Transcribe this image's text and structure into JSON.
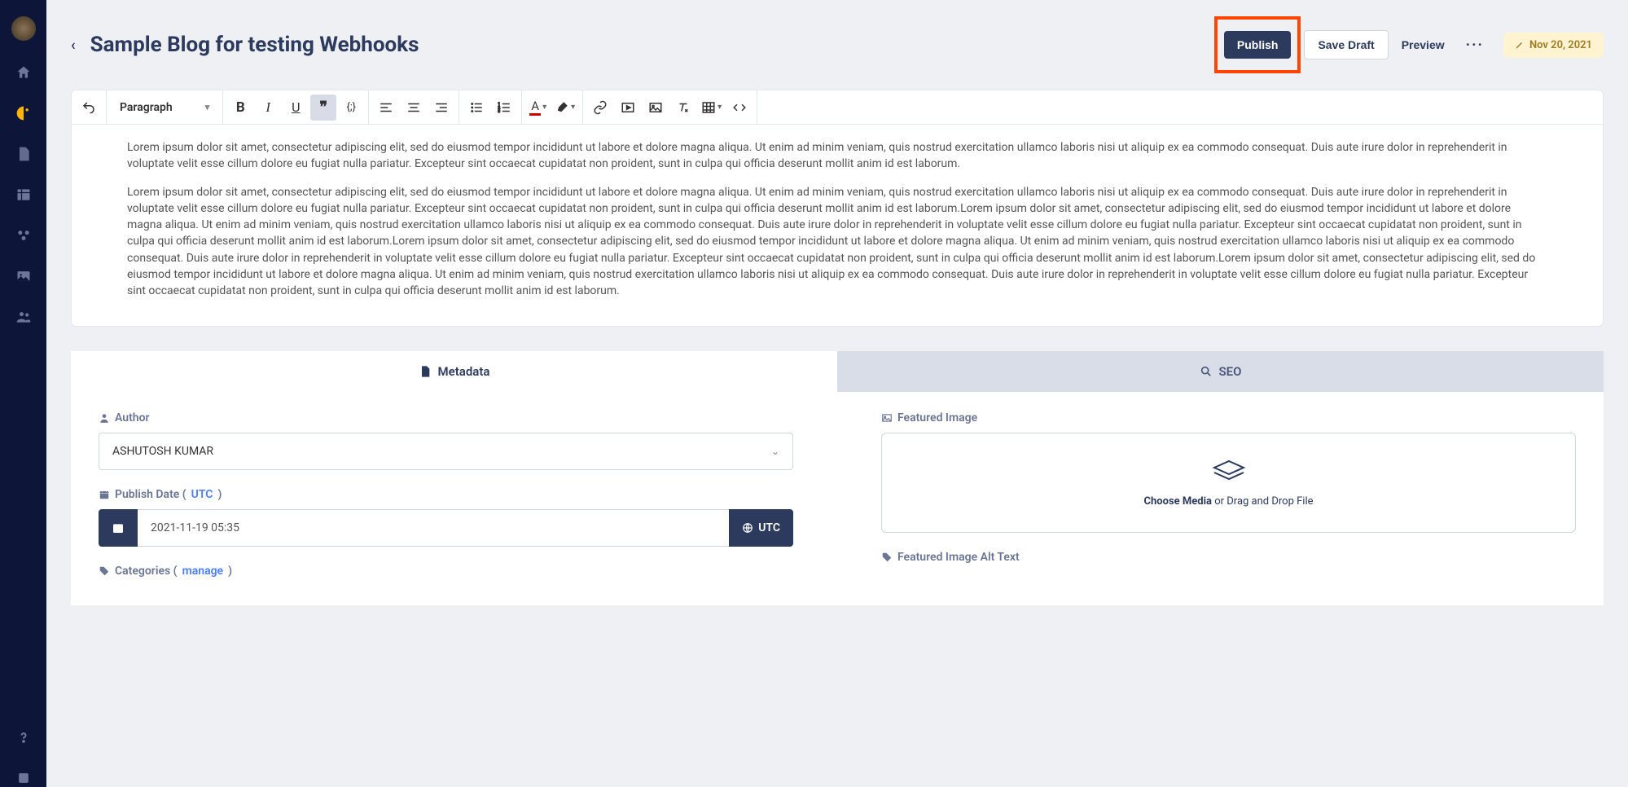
{
  "header": {
    "title": "Sample Blog for testing Webhooks",
    "publish": "Publish",
    "save_draft": "Save Draft",
    "preview": "Preview",
    "date_label": "Nov 20, 2021"
  },
  "toolbar": {
    "paragraph": "Paragraph"
  },
  "body": {
    "p1": "Lorem ipsum dolor sit amet, consectetur adipiscing elit, sed do eiusmod tempor incididunt ut labore et dolore magna aliqua. Ut enim ad minim veniam, quis nostrud exercitation ullamco laboris nisi ut aliquip ex ea commodo consequat. Duis aute irure dolor in reprehenderit in voluptate velit esse cillum dolore eu fugiat nulla pariatur. Excepteur sint occaecat cupidatat non proident, sunt in culpa qui officia deserunt mollit anim id est laborum.",
    "p2": "Lorem ipsum dolor sit amet, consectetur adipiscing elit, sed do eiusmod tempor incididunt ut labore et dolore magna aliqua. Ut enim ad minim veniam, quis nostrud exercitation ullamco laboris nisi ut aliquip ex ea commodo consequat. Duis aute irure dolor in reprehenderit in voluptate velit esse cillum dolore eu fugiat nulla pariatur. Excepteur sint occaecat cupidatat non proident, sunt in culpa qui officia deserunt mollit anim id est laborum.Lorem ipsum dolor sit amet, consectetur adipiscing elit, sed do eiusmod tempor incididunt ut labore et dolore magna aliqua. Ut enim ad minim veniam, quis nostrud exercitation ullamco laboris nisi ut aliquip ex ea commodo consequat. Duis aute irure dolor in reprehenderit in voluptate velit esse cillum dolore eu fugiat nulla pariatur. Excepteur sint occaecat cupidatat non proident, sunt in culpa qui officia deserunt mollit anim id est laborum.Lorem ipsum dolor sit amet, consectetur adipiscing elit, sed do eiusmod tempor incididunt ut labore et dolore magna aliqua. Ut enim ad minim veniam, quis nostrud exercitation ullamco laboris nisi ut aliquip ex ea commodo consequat. Duis aute irure dolor in reprehenderit in voluptate velit esse cillum dolore eu fugiat nulla pariatur. Excepteur sint occaecat cupidatat non proident, sunt in culpa qui officia deserunt mollit anim id est laborum.Lorem ipsum dolor sit amet, consectetur adipiscing elit, sed do eiusmod tempor incididunt ut labore et dolore magna aliqua. Ut enim ad minim veniam, quis nostrud exercitation ullamco laboris nisi ut aliquip ex ea commodo consequat. Duis aute irure dolor in reprehenderit in voluptate velit esse cillum dolore eu fugiat nulla pariatur. Excepteur sint occaecat cupidatat non proident, sunt in culpa qui officia deserunt mollit anim id est laborum."
  },
  "tabs": {
    "metadata": "Metadata",
    "seo": "SEO"
  },
  "meta": {
    "author_label": "Author",
    "author_value": "ASHUTOSH KUMAR",
    "publish_date_prefix": "Publish Date ( ",
    "utc": "UTC",
    "publish_date_suffix": " )",
    "publish_date_value": "2021-11-19 05:35",
    "utc_btn": "UTC",
    "categories_prefix": "Categories (",
    "manage": "manage",
    "categories_suffix": ")",
    "featured_image": "Featured Image",
    "choose_media": "Choose Media",
    "drag_drop": " or Drag and Drop File",
    "alt_text": "Featured Image Alt Text"
  }
}
